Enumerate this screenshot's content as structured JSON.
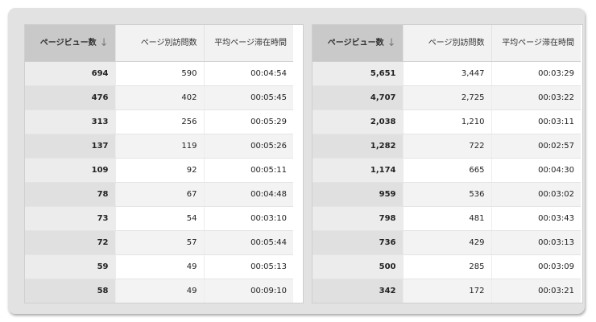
{
  "tables": [
    {
      "headers": {
        "pageviews": "ページビュー数",
        "unique": "ページ別訪問数",
        "avg_time": "平均ページ滞在時間"
      },
      "rows": [
        {
          "pageviews": "694",
          "unique": "590",
          "avg_time": "00:04:54"
        },
        {
          "pageviews": "476",
          "unique": "402",
          "avg_time": "00:05:45"
        },
        {
          "pageviews": "313",
          "unique": "256",
          "avg_time": "00:05:29"
        },
        {
          "pageviews": "137",
          "unique": "119",
          "avg_time": "00:05:26"
        },
        {
          "pageviews": "109",
          "unique": "92",
          "avg_time": "00:05:11"
        },
        {
          "pageviews": "78",
          "unique": "67",
          "avg_time": "00:04:48"
        },
        {
          "pageviews": "73",
          "unique": "54",
          "avg_time": "00:03:10"
        },
        {
          "pageviews": "72",
          "unique": "57",
          "avg_time": "00:05:44"
        },
        {
          "pageviews": "59",
          "unique": "49",
          "avg_time": "00:05:13"
        },
        {
          "pageviews": "58",
          "unique": "49",
          "avg_time": "00:09:10"
        }
      ]
    },
    {
      "headers": {
        "pageviews": "ページビュー数",
        "unique": "ページ別訪問数",
        "avg_time": "平均ページ滞在時間"
      },
      "rows": [
        {
          "pageviews": "5,651",
          "unique": "3,447",
          "avg_time": "00:03:29"
        },
        {
          "pageviews": "4,707",
          "unique": "2,725",
          "avg_time": "00:03:22"
        },
        {
          "pageviews": "2,038",
          "unique": "1,210",
          "avg_time": "00:03:11"
        },
        {
          "pageviews": "1,282",
          "unique": "722",
          "avg_time": "00:02:57"
        },
        {
          "pageviews": "1,174",
          "unique": "665",
          "avg_time": "00:04:30"
        },
        {
          "pageviews": "959",
          "unique": "536",
          "avg_time": "00:03:02"
        },
        {
          "pageviews": "798",
          "unique": "481",
          "avg_time": "00:03:43"
        },
        {
          "pageviews": "736",
          "unique": "429",
          "avg_time": "00:03:13"
        },
        {
          "pageviews": "500",
          "unique": "285",
          "avg_time": "00:03:09"
        },
        {
          "pageviews": "342",
          "unique": "172",
          "avg_time": "00:03:21"
        }
      ]
    }
  ],
  "sort": {
    "column": "pageviews",
    "direction": "descending",
    "icon": "sort-down-arrow-icon"
  },
  "colors": {
    "frame": "#e2e2e2",
    "sorted_header": "#c9c9c9",
    "sorted_column": "#ececec",
    "row_alt": "#f3f3f3"
  }
}
